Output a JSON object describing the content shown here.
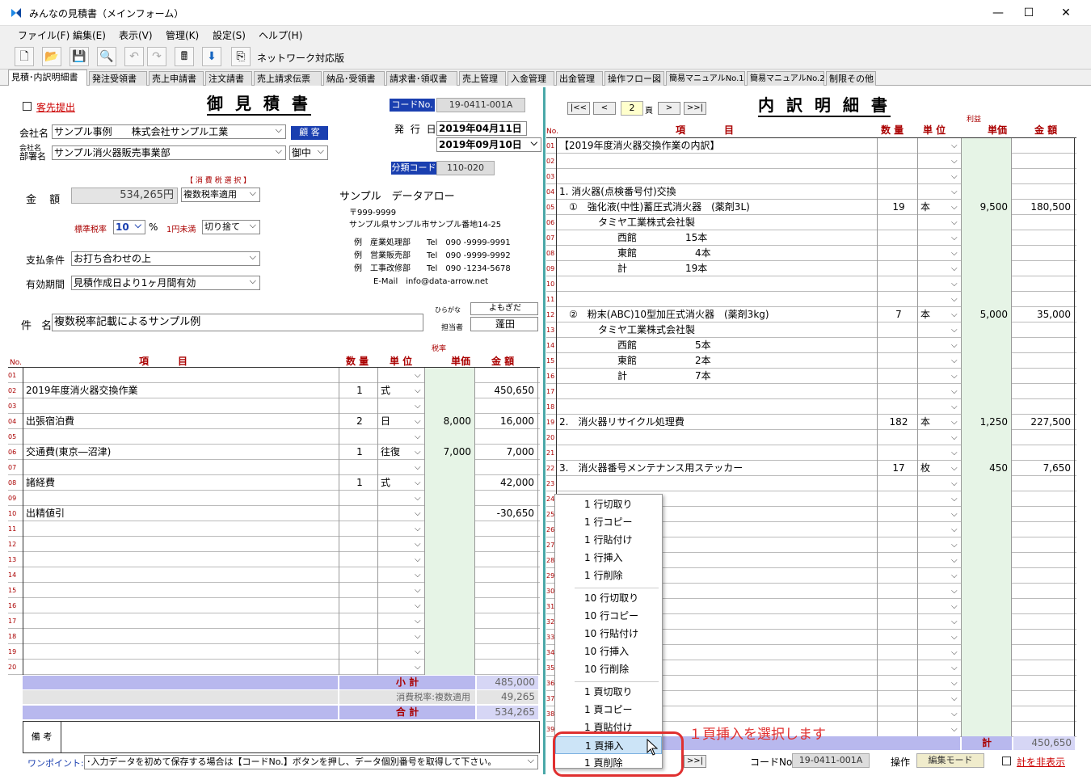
{
  "window": {
    "title": "みんなの見積書（メインフォーム）",
    "min": "—",
    "max": "☐",
    "close": "✕"
  },
  "menu": [
    "ファイル(F)",
    "編集(E)",
    "表示(V)",
    "管理(K)",
    "設定(S)",
    "ヘルプ(H)"
  ],
  "toolbar": {
    "network_label": "ネットワーク対応版"
  },
  "tabs": [
    "見積･内訳明細書",
    "発注受領書",
    "売上申請書",
    "注文請書",
    "売上請求伝票",
    "納品･受領書",
    "請求書･領収書",
    "売上管理",
    "入金管理",
    "出金管理",
    "操作フロー図",
    "簡易マニュアルNo.1",
    "簡易マニュアルNo.2",
    "制限その他"
  ],
  "estimate": {
    "submit_label": "客先提出",
    "title": "御 見 積 書",
    "code_badge": "コードNo.",
    "code_value": "19-0411-001A",
    "date_label": "発 行 日",
    "issue_date": "2019年04月11日",
    "expiry_date": "2019年09月10日",
    "category_badge": "分類コード",
    "category_code": "110-020",
    "company_label": "会社名",
    "company": "サンプル事例　　株式会社サンプル工業",
    "customer_btn": "顧 客",
    "dept_label_1": "会社名",
    "dept_label_2": "部署名",
    "dept": "サンプル消火器販売事業部",
    "honorific": "御中",
    "tax_select_label": "【 消 費 税 選 択 】",
    "tax_select": "複数税率適用",
    "amount_label": "金 額",
    "amount": "534,265円",
    "std_rate_label": "標準税率",
    "std_rate": "10",
    "pct": "%",
    "round_label": "1円未満",
    "round": "切り捨て",
    "payment_label": "支払条件",
    "payment": "お打ち合わせの上",
    "valid_label": "有効期間",
    "valid": "見積作成日より1ヶ月間有効",
    "subject_label": "件 名",
    "subject": "複数税率記載によるサンプル例",
    "kana_label": "ひらがな",
    "kana": "よもぎだ",
    "staff_label": "担当者",
    "staff": "蓬田",
    "issuer": {
      "name": "サンプル　データアロー",
      "zip": "〒999-9999",
      "addr": "サンプル県サンプル市サンプル番地14-25",
      "lines": [
        "例　産業処理部　　Tel　090 -9999-9991",
        "例　営業販売部　　Tel　090 -9999-9992",
        "例　工事改修部　　Tel　090 -1234-5678",
        "E-Mail　info@data-arrow.net"
      ]
    },
    "headers": {
      "no": "No.",
      "item": "項　　　目",
      "qty": "数 量",
      "unit": "単 位",
      "rate": "税率",
      "price": "単価",
      "amount": "金 額"
    },
    "rows": [
      {
        "no": "01",
        "item": "",
        "qty": "",
        "unit": "",
        "price": "",
        "amount": ""
      },
      {
        "no": "02",
        "item": "2019年度消火器交換作業",
        "qty": "1",
        "unit": "式",
        "price": "",
        "amount": "450,650"
      },
      {
        "no": "03",
        "item": "",
        "qty": "",
        "unit": "",
        "price": "",
        "amount": ""
      },
      {
        "no": "04",
        "item": "出張宿泊費",
        "qty": "2",
        "unit": "日",
        "price": "8,000",
        "amount": "16,000"
      },
      {
        "no": "05",
        "item": "",
        "qty": "",
        "unit": "",
        "price": "",
        "amount": ""
      },
      {
        "no": "06",
        "item": "交通費(東京―沼津)",
        "qty": "1",
        "unit": "往復",
        "price": "7,000",
        "amount": "7,000"
      },
      {
        "no": "07",
        "item": "",
        "qty": "",
        "unit": "",
        "price": "",
        "amount": ""
      },
      {
        "no": "08",
        "item": "諸経費",
        "qty": "1",
        "unit": "式",
        "price": "",
        "amount": "42,000"
      },
      {
        "no": "09",
        "item": "",
        "qty": "",
        "unit": "",
        "price": "",
        "amount": ""
      },
      {
        "no": "10",
        "item": "出精値引",
        "qty": "",
        "unit": "",
        "price": "",
        "amount": "-30,650"
      },
      {
        "no": "11",
        "item": "",
        "qty": "",
        "unit": "",
        "price": "",
        "amount": ""
      },
      {
        "no": "12",
        "item": "",
        "qty": "",
        "unit": "",
        "price": "",
        "amount": ""
      },
      {
        "no": "13",
        "item": "",
        "qty": "",
        "unit": "",
        "price": "",
        "amount": ""
      },
      {
        "no": "14",
        "item": "",
        "qty": "",
        "unit": "",
        "price": "",
        "amount": ""
      },
      {
        "no": "15",
        "item": "",
        "qty": "",
        "unit": "",
        "price": "",
        "amount": ""
      },
      {
        "no": "16",
        "item": "",
        "qty": "",
        "unit": "",
        "price": "",
        "amount": ""
      },
      {
        "no": "17",
        "item": "",
        "qty": "",
        "unit": "",
        "price": "",
        "amount": ""
      },
      {
        "no": "18",
        "item": "",
        "qty": "",
        "unit": "",
        "price": "",
        "amount": ""
      },
      {
        "no": "19",
        "item": "",
        "qty": "",
        "unit": "",
        "price": "",
        "amount": ""
      },
      {
        "no": "20",
        "item": "",
        "qty": "",
        "unit": "",
        "price": "",
        "amount": ""
      }
    ],
    "subtotal_label": "小 計",
    "subtotal": "485,000",
    "tax_label": "消費税率:複数適用",
    "tax": "49,265",
    "total_label": "合 計",
    "total": "534,265",
    "remarks_label": "備 考",
    "onepoint_label": "ワンポイント:",
    "onepoint": "･入力データを初めて保存する場合は【コードNo.】ボタンを押し、データ個別番号を取得して下さい。"
  },
  "detail": {
    "title": "内 訳 明 細 書",
    "page": "2",
    "page_label": "頁",
    "nav": [
      "|<<",
      "<",
      ">",
      ">>|"
    ],
    "headers": {
      "no": "No.",
      "item": "項　　　　目",
      "qty": "数 量",
      "unit": "単 位",
      "margin": "利益",
      "price": "単価",
      "amount": "金 額"
    },
    "rows": [
      {
        "no": "01",
        "item": "【2019年度消火器交換作業の内訳】",
        "qty": "",
        "unit": "",
        "price": "",
        "amount": ""
      },
      {
        "no": "02",
        "item": "",
        "qty": "",
        "unit": "",
        "price": "",
        "amount": ""
      },
      {
        "no": "03",
        "item": "",
        "qty": "",
        "unit": "",
        "price": "",
        "amount": ""
      },
      {
        "no": "04",
        "item": "1. 消火器(点検番号付)交換",
        "qty": "",
        "unit": "",
        "price": "",
        "amount": ""
      },
      {
        "no": "05",
        "item": "　①　強化液(中性)蓄圧式消火器　(薬剤3L)",
        "qty": "19",
        "unit": "本",
        "price": "9,500",
        "amount": "180,500"
      },
      {
        "no": "06",
        "item": "　　　　タミヤ工業株式会社製",
        "qty": "",
        "unit": "",
        "price": "",
        "amount": ""
      },
      {
        "no": "07",
        "item": "　　　　　　西館　　　　　15本",
        "qty": "",
        "unit": "",
        "price": "",
        "amount": ""
      },
      {
        "no": "08",
        "item": "　　　　　　東館　　　　　　4本",
        "qty": "",
        "unit": "",
        "price": "",
        "amount": ""
      },
      {
        "no": "09",
        "item": "　　　　　　計　　　　　　19本",
        "qty": "",
        "unit": "",
        "price": "",
        "amount": ""
      },
      {
        "no": "10",
        "item": "",
        "qty": "",
        "unit": "",
        "price": "",
        "amount": ""
      },
      {
        "no": "11",
        "item": "",
        "qty": "",
        "unit": "",
        "price": "",
        "amount": ""
      },
      {
        "no": "12",
        "item": "　②　粉末(ABC)10型加圧式消火器　(薬剤3kg)",
        "qty": "7",
        "unit": "本",
        "price": "5,000",
        "amount": "35,000"
      },
      {
        "no": "13",
        "item": "　　　　タミヤ工業株式会社製",
        "qty": "",
        "unit": "",
        "price": "",
        "amount": ""
      },
      {
        "no": "14",
        "item": "　　　　　　西館　　　　　　5本",
        "qty": "",
        "unit": "",
        "price": "",
        "amount": ""
      },
      {
        "no": "15",
        "item": "　　　　　　東館　　　　　　2本",
        "qty": "",
        "unit": "",
        "price": "",
        "amount": ""
      },
      {
        "no": "16",
        "item": "　　　　　　計　　　　　　　7本",
        "qty": "",
        "unit": "",
        "price": "",
        "amount": ""
      },
      {
        "no": "17",
        "item": "",
        "qty": "",
        "unit": "",
        "price": "",
        "amount": ""
      },
      {
        "no": "18",
        "item": "",
        "qty": "",
        "unit": "",
        "price": "",
        "amount": ""
      },
      {
        "no": "19",
        "item": "2.　消火器リサイクル処理費",
        "qty": "182",
        "unit": "本",
        "price": "1,250",
        "amount": "227,500"
      },
      {
        "no": "20",
        "item": "",
        "qty": "",
        "unit": "",
        "price": "",
        "amount": ""
      },
      {
        "no": "21",
        "item": "",
        "qty": "",
        "unit": "",
        "price": "",
        "amount": ""
      },
      {
        "no": "22",
        "item": "3.　消火器番号メンテナンス用ステッカー",
        "qty": "17",
        "unit": "枚",
        "price": "450",
        "amount": "7,650"
      },
      {
        "no": "23",
        "item": "",
        "qty": "",
        "unit": "",
        "price": "",
        "amount": ""
      },
      {
        "no": "24",
        "item": "",
        "qty": "",
        "unit": "",
        "price": "",
        "amount": ""
      },
      {
        "no": "25",
        "item": "",
        "qty": "",
        "unit": "",
        "price": "",
        "amount": ""
      },
      {
        "no": "26",
        "item": "",
        "qty": "",
        "unit": "",
        "price": "",
        "amount": ""
      },
      {
        "no": "27",
        "item": "",
        "qty": "",
        "unit": "",
        "price": "",
        "amount": ""
      },
      {
        "no": "28",
        "item": "",
        "qty": "",
        "unit": "",
        "price": "",
        "amount": ""
      },
      {
        "no": "29",
        "item": "",
        "qty": "",
        "unit": "",
        "price": "",
        "amount": ""
      },
      {
        "no": "30",
        "item": "",
        "qty": "",
        "unit": "",
        "price": "",
        "amount": ""
      },
      {
        "no": "31",
        "item": "",
        "qty": "",
        "unit": "",
        "price": "",
        "amount": ""
      },
      {
        "no": "32",
        "item": "",
        "qty": "",
        "unit": "",
        "price": "",
        "amount": ""
      },
      {
        "no": "33",
        "item": "",
        "qty": "",
        "unit": "",
        "price": "",
        "amount": ""
      },
      {
        "no": "34",
        "item": "",
        "qty": "",
        "unit": "",
        "price": "",
        "amount": ""
      },
      {
        "no": "35",
        "item": "",
        "qty": "",
        "unit": "",
        "price": "",
        "amount": ""
      },
      {
        "no": "36",
        "item": "",
        "qty": "",
        "unit": "",
        "price": "",
        "amount": ""
      },
      {
        "no": "37",
        "item": "",
        "qty": "",
        "unit": "",
        "price": "",
        "amount": ""
      },
      {
        "no": "38",
        "item": "",
        "qty": "",
        "unit": "",
        "price": "",
        "amount": ""
      },
      {
        "no": "39",
        "item": "",
        "qty": "",
        "unit": "",
        "price": "",
        "amount": ""
      }
    ],
    "total_label": "計",
    "total": "450,650",
    "code_label": "コードNo.",
    "code_value": "19-0411-001A",
    "op_label": "操作",
    "op_mode": "編集モード",
    "hide_total": "計を非表示"
  },
  "context_menu": {
    "items": [
      "1 行切取り",
      "1 行コピー",
      "1 行貼付け",
      "1 行挿入",
      "1 行削除",
      "10 行切取り",
      "10 行コピー",
      "10 行貼付け",
      "10 行挿入",
      "10 行削除",
      "1 頁切取り",
      "1 頁コピー",
      "1 頁貼付け",
      "1 頁挿入",
      "1 頁削除"
    ],
    "selected_index": 13
  },
  "annotation": "１頁挿入を選択します",
  "colors": {
    "accent": "#1a3fb0",
    "red": "#cc0000",
    "green_cell": "#e6f4e6",
    "summary": "#b8b8ee"
  }
}
